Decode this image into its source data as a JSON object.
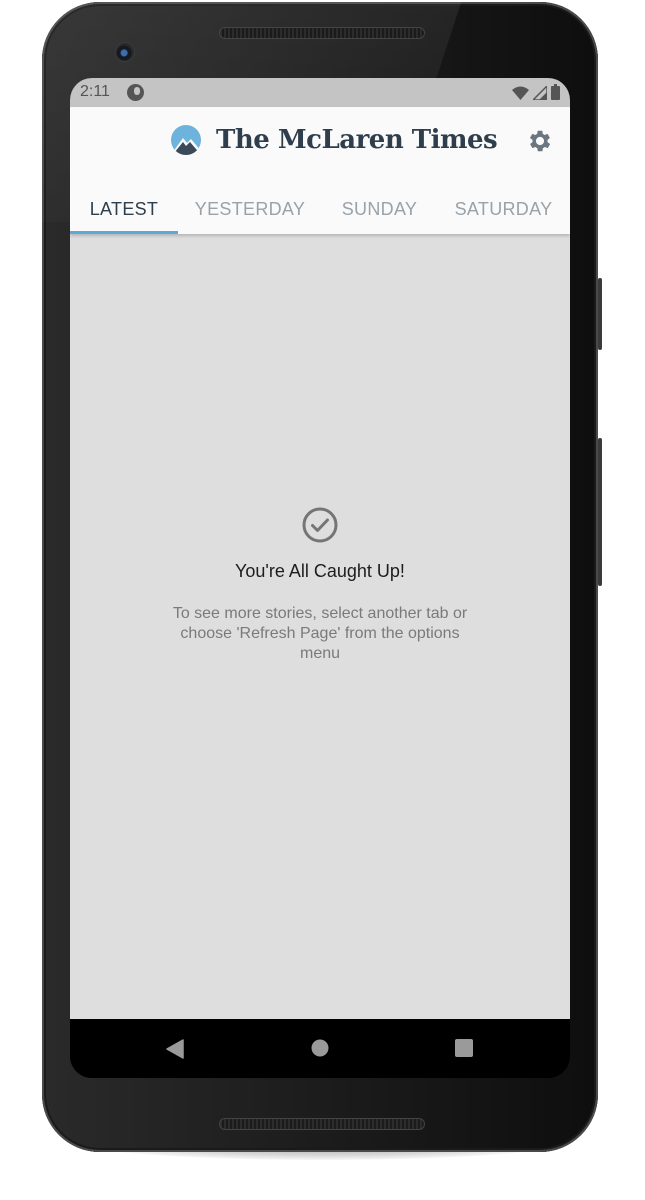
{
  "status_bar": {
    "time": "2:11",
    "icons": [
      "app-notification-icon",
      "wifi-icon",
      "cellular-signal-icon",
      "battery-icon"
    ]
  },
  "app_bar": {
    "title": "The McLaren Times",
    "logo_icon": "mountain-logo-icon",
    "settings_icon": "gear-icon",
    "brand_color": "#2f3e4c",
    "accent_color": "#5aa9d6"
  },
  "tabs": [
    {
      "label": "LATEST",
      "active": true
    },
    {
      "label": "YESTERDAY",
      "active": false
    },
    {
      "label": "SUNDAY",
      "active": false
    },
    {
      "label": "SATURDAY",
      "active": false
    }
  ],
  "empty_state": {
    "icon": "check-circle-icon",
    "title": "You're All Caught Up!",
    "message": "To see more stories, select another tab or choose 'Refresh Page' from the options menu"
  },
  "nav_bar": {
    "back_icon": "back-triangle-icon",
    "home_icon": "home-circle-icon",
    "recents_icon": "recents-square-icon"
  }
}
